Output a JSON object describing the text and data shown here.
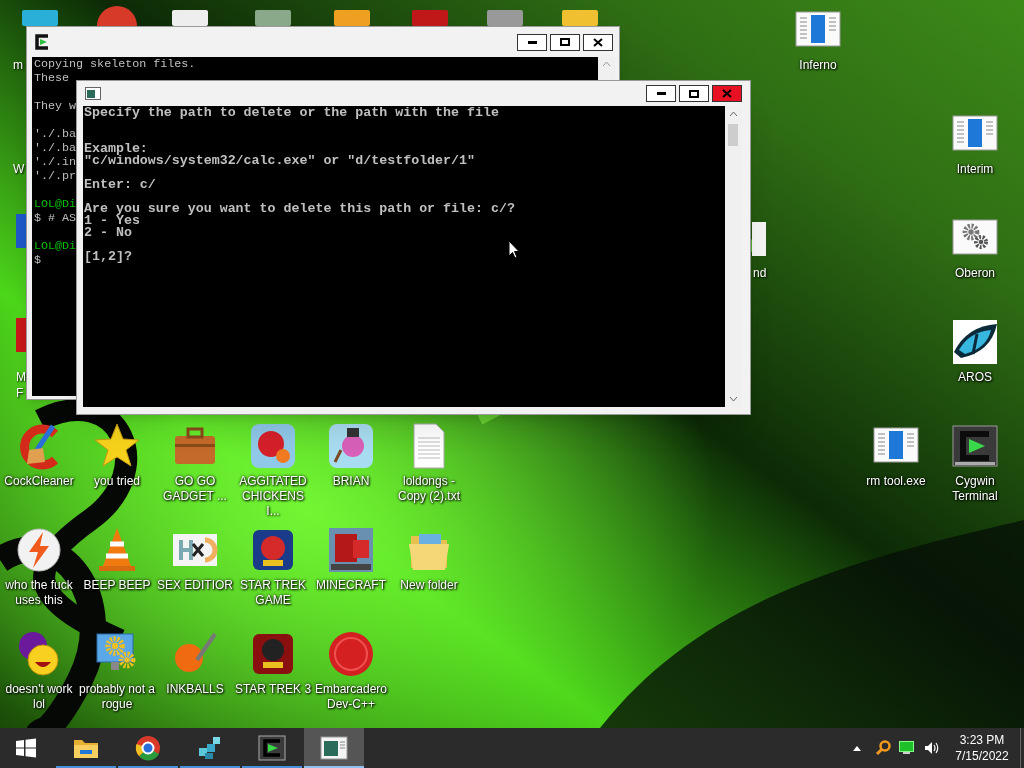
{
  "desktop": {
    "edge_labels": [
      "m",
      "W",
      "M",
      "F",
      "nd"
    ],
    "icons": [
      {
        "label": "Inferno"
      },
      {
        "label": "Interim"
      },
      {
        "label": "Oberon"
      },
      {
        "label": "AROS"
      },
      {
        "label": "CockCleaner"
      },
      {
        "label": "you tried"
      },
      {
        "label": "GO GO GADGET ..."
      },
      {
        "label": "AGGITATED CHICKENS I..."
      },
      {
        "label": "BRIAN"
      },
      {
        "label": "loldongs - Copy (2).txt"
      },
      {
        "label": "rm tool.exe"
      },
      {
        "label": "Cygwin Terminal"
      },
      {
        "label": "who the fuck uses this"
      },
      {
        "label": "BEEP BEEP"
      },
      {
        "label": "SEX EDITIOR"
      },
      {
        "label": "STAR TREK GAME"
      },
      {
        "label": "MINECRAFT"
      },
      {
        "label": "New folder"
      },
      {
        "label": "doesn't work lol"
      },
      {
        "label": "probably not a rogue"
      },
      {
        "label": "INKBALLS"
      },
      {
        "label": "STAR TREK 3"
      },
      {
        "label": "Embarcadero Dev-C++"
      }
    ]
  },
  "back_window": {
    "lines": [
      {
        "text": "Copying skeleton files.",
        "kind": "plain",
        "color": "#c0c0c0"
      },
      {
        "text": "These",
        "kind": "plain",
        "color": "#c0c0c0"
      },
      {
        "text": "They w",
        "kind": "after_gap",
        "color": "#c0c0c0"
      },
      {
        "text": "'./.ba",
        "kind": "after_gap",
        "color": "#c0c0c0"
      },
      {
        "text": "'./.ba",
        "kind": "plain",
        "color": "#c0c0c0"
      },
      {
        "text": "'./.in",
        "kind": "plain",
        "color": "#c0c0c0"
      },
      {
        "text": "'./.pr",
        "kind": "plain",
        "color": "#c0c0c0"
      },
      {
        "text": "LOL@Di",
        "kind": "after_gap",
        "color": "#00c000"
      },
      {
        "text": "$ # AS",
        "kind": "plain",
        "color": "#c0c0c0"
      },
      {
        "text": "LOL@Di",
        "kind": "after_gap",
        "color": "#00c000"
      },
      {
        "text": "$",
        "kind": "plain",
        "color": "#c0c0c0"
      }
    ]
  },
  "front_window": {
    "lines": [
      {
        "text": "Specify the path to delete or the path with the file",
        "kind": "plain"
      },
      {
        "text": "Example:",
        "kind": "after_double_gap"
      },
      {
        "text": "\"c/windows/system32/calc.exe\" or \"d/testfolder/1\"",
        "kind": "plain"
      },
      {
        "text": "Enter: c/",
        "kind": "after_gap"
      },
      {
        "text": "Are you sure you want to delete this path or file: c/?",
        "kind": "after_gap"
      },
      {
        "text": "1 - Yes",
        "kind": "plain"
      },
      {
        "text": "2 - No",
        "kind": "plain"
      },
      {
        "text": "[1,2]?",
        "kind": "after_gap"
      }
    ]
  },
  "taskbar": {
    "items": [
      {
        "running": true,
        "selected": false
      },
      {
        "running": true,
        "selected": false
      },
      {
        "running": true,
        "selected": false
      },
      {
        "running": true,
        "selected": false
      },
      {
        "running": true,
        "selected": true
      }
    ],
    "clock": {
      "time": "3:23 PM",
      "date": "7/15/2022"
    }
  }
}
